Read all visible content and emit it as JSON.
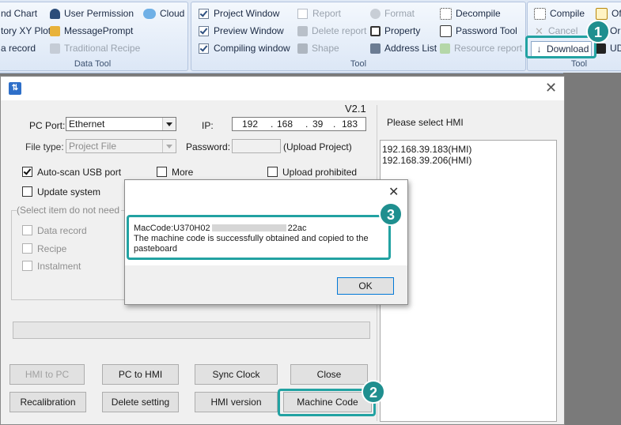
{
  "ribbon": {
    "data_tool": {
      "items": [
        "nd Chart",
        "User Permission",
        "Cloud",
        "tory XY Plot",
        "MessagePrompt",
        "a record",
        "Traditional Recipe"
      ],
      "label": "Data Tool"
    },
    "tool": {
      "items": [
        "Project Window",
        "Report",
        "Format",
        "Decompile",
        "Preview Window",
        "Delete report",
        "Property",
        "Password Tool",
        "Compiling window",
        "Shape",
        "Address List",
        "Resource report"
      ],
      "label": "Tool"
    },
    "tool2": {
      "items": [
        "Compile",
        "Of",
        "Cancel",
        "Or",
        "Download",
        "UD"
      ],
      "label": "Tool"
    }
  },
  "dialog": {
    "version": "V2.1",
    "pc_port_label": "PC Port:",
    "pc_port_value": "Ethernet",
    "ip_label": "IP:",
    "ip": [
      "192",
      "168",
      "39",
      "183"
    ],
    "ip_dots": [
      "."
    ],
    "file_type_label": "File type:",
    "file_type_value": "Project File",
    "password_label": "Password:",
    "upload_project": "(Upload Project)",
    "auto_scan": "Auto-scan USB port",
    "more": "More",
    "upload_prohibited": "Upload prohibited",
    "update_system": "Update system",
    "select_item": "(Select item do not need",
    "data_record": "Data record",
    "recipe": "Recipe",
    "instalment": "Instalment",
    "hmi_header": "Please select HMI",
    "hmi_list": [
      "192.168.39.183(HMI)",
      "192.168.39.206(HMI)"
    ],
    "buttons": {
      "hmi_to_pc": "HMI to PC",
      "pc_to_hmi": "PC to HMI",
      "sync_clock": "Sync Clock",
      "close": "Close",
      "recalibration": "Recalibration",
      "delete_setting": "Delete setting",
      "hmi_version": "HMI version",
      "machine_code": "Machine Code"
    }
  },
  "popup": {
    "mac_prefix": "MacCode:U370H02",
    "mac_suffix": "22ac",
    "message": "The machine code is successfully obtained and copied to the pasteboard",
    "ok": "OK"
  },
  "badges": [
    "1",
    "2",
    "3"
  ],
  "colors": {
    "callout": "#22a2a2",
    "badge": "#1f8f8f"
  }
}
